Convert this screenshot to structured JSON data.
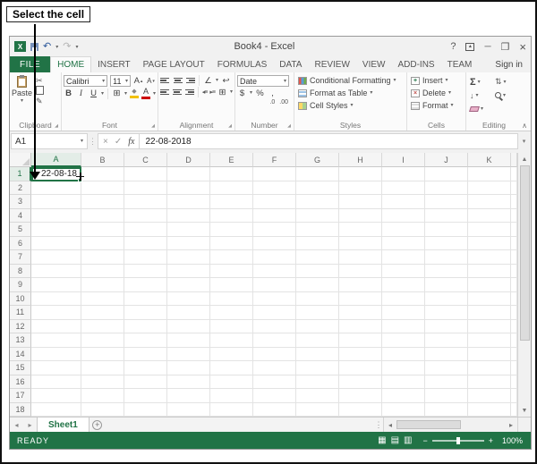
{
  "callout": {
    "label": "Select the cell"
  },
  "icons": {
    "dropdown": "▾",
    "up": "▴",
    "left": "◂",
    "right": "▸",
    "scroll_up": "▲",
    "scroll_down": "▼",
    "cut": "✂",
    "format_painter": "✎",
    "borders": "⊞",
    "merge_center": "⊞",
    "orientation": "∠",
    "wrap_text": "↩",
    "fill_color": "◆",
    "indent_decrease": "◂≡",
    "indent_increase": "▸≡",
    "undo": "↶",
    "redo": "↷",
    "help": "?",
    "minimize": "─",
    "restore": "❐",
    "close": "×",
    "cancel": "×",
    "enter": "✓",
    "dots": "⋮",
    "collapse_ribbon": "∧",
    "launcher": "◢",
    "fill_down": "↓",
    "sort_filter": "⇅",
    "view_normal": "▦",
    "view_page_layout": "▤",
    "view_page_break": "▥"
  },
  "window": {
    "title": "Book4 - Excel"
  },
  "ribbon_tabs": {
    "file": "FILE",
    "tabs": [
      "HOME",
      "INSERT",
      "PAGE LAYOUT",
      "FORMULAS",
      "DATA",
      "REVIEW",
      "VIEW",
      "ADD-INS",
      "TEAM"
    ],
    "active_tab": "HOME",
    "sign_in": "Sign in"
  },
  "ribbon": {
    "clipboard": {
      "group_label": "Clipboard",
      "paste_label": "Paste"
    },
    "font": {
      "group_label": "Font",
      "font_name": "Calibri",
      "font_size": "11",
      "bold": "B",
      "italic": "I",
      "underline": "U",
      "grow_font": "A",
      "shrink_font": "A",
      "font_color": "A"
    },
    "alignment": {
      "group_label": "Alignment"
    },
    "number": {
      "group_label": "Number",
      "format_value": "Date",
      "currency": "$",
      "percent": "%",
      "comma": ",",
      "increase_decimal": ".0",
      "decrease_decimal": ".00"
    },
    "styles": {
      "group_label": "Styles",
      "items": [
        "Conditional Formatting",
        "Format as Table",
        "Cell Styles"
      ]
    },
    "cells": {
      "group_label": "Cells",
      "items": [
        "Insert",
        "Delete",
        "Format"
      ]
    },
    "editing": {
      "group_label": "Editing",
      "autosum": "Σ"
    }
  },
  "formula_bar": {
    "name_box": "A1",
    "fx_label": "fx",
    "value": "22-08-2018"
  },
  "grid": {
    "column_headers": [
      "A",
      "B",
      "C",
      "D",
      "E",
      "F",
      "G",
      "H",
      "I",
      "J",
      "K"
    ],
    "rows": [
      "1",
      "2",
      "3",
      "4",
      "5",
      "6",
      "7",
      "8",
      "9",
      "10",
      "11",
      "12",
      "13",
      "14",
      "15",
      "16",
      "17",
      "18"
    ],
    "selected": {
      "cell": "A1",
      "value": "22-08-18",
      "column": "A",
      "row": "1"
    }
  },
  "sheet_bar": {
    "active_sheet": "Sheet1"
  },
  "status_bar": {
    "mode": "READY",
    "zoom_minus": "−",
    "zoom_plus": "+",
    "zoom_level": "100%"
  },
  "colors": {
    "accent_green": "#217346",
    "selection_border": "#217346"
  }
}
